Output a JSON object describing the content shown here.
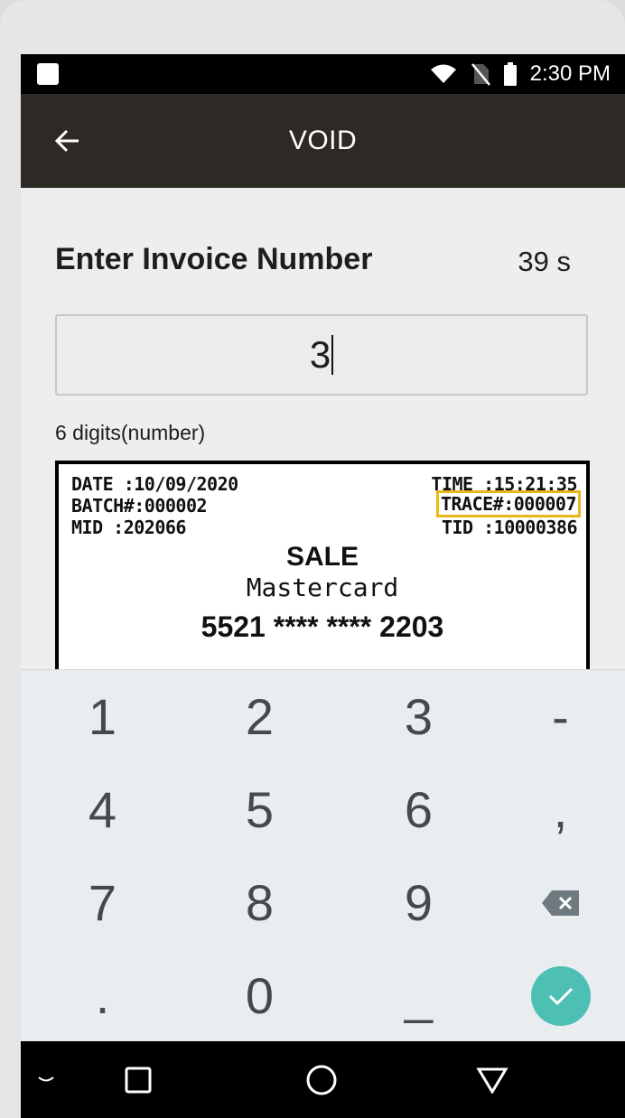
{
  "status_bar": {
    "time": "2:30 PM",
    "icons": [
      "notification-square-icon",
      "wifi-icon",
      "no-sim-icon",
      "battery-icon"
    ]
  },
  "toolbar": {
    "title": "VOID",
    "back_icon": "arrow-left-icon"
  },
  "form": {
    "heading": "Enter Invoice Number",
    "timer": "39 s",
    "input_value": "3",
    "hint": "6 digits(number)"
  },
  "receipt": {
    "date": "DATE :10/09/2020",
    "time": "TIME :15:21:35",
    "batch": "BATCH#:000002",
    "trace": "TRACE#:000007",
    "mid": "MID :202066",
    "tid": "TID :10000386",
    "type": "SALE",
    "card_brand": "Mastercard",
    "card_number": "5521 **** **** 2203",
    "highlight_color": "#e8b818"
  },
  "keyboard": {
    "row1": [
      "1",
      "2",
      "3",
      "-"
    ],
    "row2": [
      "4",
      "5",
      "6",
      ","
    ],
    "row3": [
      "7",
      "8",
      "9"
    ],
    "row4": [
      ".",
      "0",
      "_"
    ],
    "backspace_icon": "backspace-icon",
    "enter_icon": "check-icon",
    "enter_color": "#4dbfb3"
  },
  "nav_bar": {
    "icons": [
      "chevron-down-icon",
      "recents-square-icon",
      "home-circle-icon",
      "back-triangle-icon"
    ]
  }
}
